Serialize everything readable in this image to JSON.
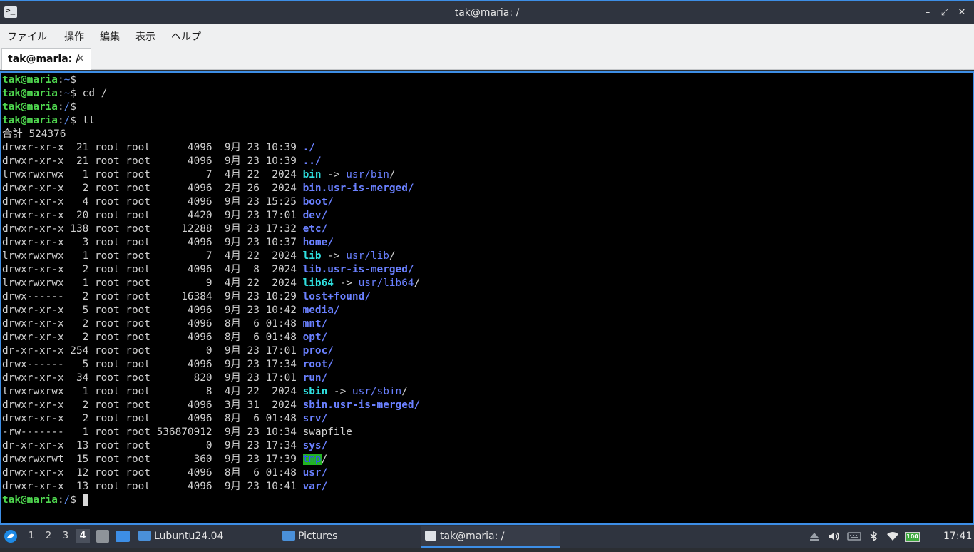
{
  "window": {
    "title": "tak@maria: /",
    "icon": "terminal-icon",
    "accent": "#3d8ee6",
    "minimize": "–",
    "maximize": "⤢",
    "close": "✕"
  },
  "menu": [
    "ファイル",
    "操作",
    "編集",
    "表示",
    "ヘルプ"
  ],
  "tab": {
    "label": "tak@maria: /",
    "close": "×"
  },
  "terminal": {
    "lines": [
      {
        "t": "prompt",
        "user": "tak@maria",
        "path": "~",
        "sym": "$ ",
        "cmd": ""
      },
      {
        "t": "prompt",
        "user": "tak@maria",
        "path": "~",
        "sym": "$ ",
        "cmd": "cd /"
      },
      {
        "t": "prompt",
        "user": "tak@maria",
        "path": "/",
        "sym": "$ ",
        "cmd": ""
      },
      {
        "t": "prompt",
        "user": "tak@maria",
        "path": "/",
        "sym": "$ ",
        "cmd": "ll"
      },
      {
        "t": "text",
        "text": "合計 524376"
      },
      {
        "t": "entry",
        "info": "drwxr-xr-x  21 root root      4096  9月 23 10:39 ",
        "name": "./",
        "kind": "dir"
      },
      {
        "t": "entry",
        "info": "drwxr-xr-x  21 root root      4096  9月 23 10:39 ",
        "name": "../",
        "kind": "dir"
      },
      {
        "t": "entry",
        "info": "lrwxrwxrwx   1 root root         7  4月 22  2024 ",
        "name": "bin",
        "kind": "link",
        "target": "usr/bin/"
      },
      {
        "t": "entry",
        "info": "drwxr-xr-x   2 root root      4096  2月 26  2024 ",
        "name": "bin.usr-is-merged",
        "kind": "dir"
      },
      {
        "t": "entry",
        "info": "drwxr-xr-x   4 root root      4096  9月 23 15:25 ",
        "name": "boot",
        "kind": "dir"
      },
      {
        "t": "entry",
        "info": "drwxr-xr-x  20 root root      4420  9月 23 17:01 ",
        "name": "dev",
        "kind": "dir"
      },
      {
        "t": "entry",
        "info": "drwxr-xr-x 138 root root     12288  9月 23 17:32 ",
        "name": "etc",
        "kind": "dir"
      },
      {
        "t": "entry",
        "info": "drwxr-xr-x   3 root root      4096  9月 23 10:37 ",
        "name": "home",
        "kind": "dir"
      },
      {
        "t": "entry",
        "info": "lrwxrwxrwx   1 root root         7  4月 22  2024 ",
        "name": "lib",
        "kind": "link",
        "target": "usr/lib/"
      },
      {
        "t": "entry",
        "info": "drwxr-xr-x   2 root root      4096  4月  8  2024 ",
        "name": "lib.usr-is-merged",
        "kind": "dir"
      },
      {
        "t": "entry",
        "info": "lrwxrwxrwx   1 root root         9  4月 22  2024 ",
        "name": "lib64",
        "kind": "link",
        "target": "usr/lib64/"
      },
      {
        "t": "entry",
        "info": "drwx------   2 root root     16384  9月 23 10:29 ",
        "name": "lost+found",
        "kind": "dir"
      },
      {
        "t": "entry",
        "info": "drwxr-xr-x   5 root root      4096  9月 23 10:42 ",
        "name": "media",
        "kind": "dir"
      },
      {
        "t": "entry",
        "info": "drwxr-xr-x   2 root root      4096  8月  6 01:48 ",
        "name": "mnt",
        "kind": "dir"
      },
      {
        "t": "entry",
        "info": "drwxr-xr-x   2 root root      4096  8月  6 01:48 ",
        "name": "opt",
        "kind": "dir"
      },
      {
        "t": "entry",
        "info": "dr-xr-xr-x 254 root root         0  9月 23 17:01 ",
        "name": "proc",
        "kind": "dir"
      },
      {
        "t": "entry",
        "info": "drwx------   5 root root      4096  9月 23 17:34 ",
        "name": "root",
        "kind": "dir"
      },
      {
        "t": "entry",
        "info": "drwxr-xr-x  34 root root       820  9月 23 17:01 ",
        "name": "run",
        "kind": "dir"
      },
      {
        "t": "entry",
        "info": "lrwxrwxrwx   1 root root         8  4月 22  2024 ",
        "name": "sbin",
        "kind": "link",
        "target": "usr/sbin/"
      },
      {
        "t": "entry",
        "info": "drwxr-xr-x   2 root root      4096  3月 31  2024 ",
        "name": "sbin.usr-is-merged",
        "kind": "dir"
      },
      {
        "t": "entry",
        "info": "drwxr-xr-x   2 root root      4096  8月  6 01:48 ",
        "name": "srv",
        "kind": "dir"
      },
      {
        "t": "entry",
        "info": "-rw-------   1 root root 536870912  9月 23 10:34 ",
        "name": "swapfile",
        "kind": "file"
      },
      {
        "t": "entry",
        "info": "dr-xr-xr-x  13 root root         0  9月 23 17:34 ",
        "name": "sys",
        "kind": "dir"
      },
      {
        "t": "entry",
        "info": "drwxrwxrwt  15 root root       360  9月 23 17:39 ",
        "name": "tmp",
        "kind": "sticky"
      },
      {
        "t": "entry",
        "info": "drwxr-xr-x  12 root root      4096  8月  6 01:48 ",
        "name": "usr",
        "kind": "dir"
      },
      {
        "t": "entry",
        "info": "drwxr-xr-x  13 root root      4096  9月 23 10:41 ",
        "name": "var",
        "kind": "dir"
      },
      {
        "t": "prompt",
        "user": "tak@maria",
        "path": "/",
        "sym": "$ ",
        "cmd": "",
        "cursor": true
      }
    ]
  },
  "taskbar": {
    "start_icon": "lubuntu-logo-icon",
    "workspaces": [
      "1",
      "2",
      "3",
      "4"
    ],
    "active_workspace": "4",
    "launchers": [
      "file-manager-icon",
      "show-desktop-icon"
    ],
    "tasks": [
      {
        "label": "Lubuntu24.04",
        "icon": "folder-icon"
      },
      {
        "label": "Pictures",
        "icon": "folder-icon"
      },
      {
        "label": "tak@maria: /",
        "icon": "terminal-icon",
        "active": true
      }
    ],
    "tray": [
      "eject-icon",
      "volume-icon",
      "keyboard-icon",
      "bluetooth-icon",
      "wifi-icon",
      "battery-icon"
    ],
    "battery_label": "100",
    "clock": "17:41"
  }
}
